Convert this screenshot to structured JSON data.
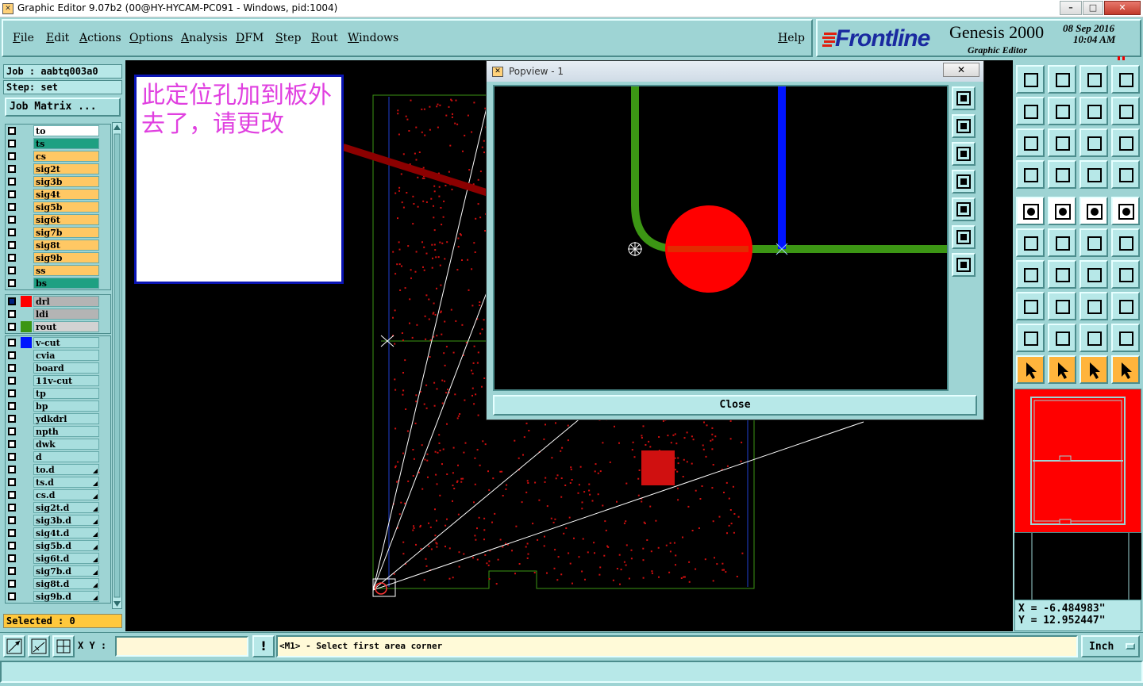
{
  "window": {
    "title": "Graphic Editor 9.07b2 (00@HY-HYCAM-PC091 - Windows, pid:1004)",
    "minimize": "–",
    "maximize": "□",
    "close": "✕"
  },
  "menu": {
    "items": [
      "File",
      "Edit",
      "Actions",
      "Options",
      "Analysis",
      "DFM",
      "Step",
      "Rout",
      "Windows"
    ],
    "help": "Help"
  },
  "brand": {
    "logo": "Frontline",
    "product": "Genesis 2000",
    "subtitle": "Graphic Editor",
    "date": "08 Sep 2016",
    "time": "10:04 AM"
  },
  "job": {
    "job_label": "Job : aabtq003a0",
    "step_label": "Step: set",
    "matrix_button": "Job Matrix ..."
  },
  "layers_board": [
    {
      "name": "to",
      "color": "#ffffff"
    },
    {
      "name": "ts",
      "color": "#1ea082"
    },
    {
      "name": "cs",
      "color": "#ffc864"
    },
    {
      "name": "sig2t",
      "color": "#ffc864"
    },
    {
      "name": "sig3b",
      "color": "#ffc864"
    },
    {
      "name": "sig4t",
      "color": "#ffc864"
    },
    {
      "name": "sig5b",
      "color": "#ffc864"
    },
    {
      "name": "sig6t",
      "color": "#ffc864"
    },
    {
      "name": "sig7b",
      "color": "#ffc864"
    },
    {
      "name": "sig8t",
      "color": "#ffc864"
    },
    {
      "name": "sig9b",
      "color": "#ffc864"
    },
    {
      "name": "ss",
      "color": "#ffc864"
    },
    {
      "name": "bs",
      "color": "#1ea082"
    }
  ],
  "layers_drill": [
    {
      "name": "drl",
      "color": "#b4b4b4",
      "swatch": "#ff0000",
      "active": true
    },
    {
      "name": "ldi",
      "color": "#b4b4b4",
      "swatch": "",
      "active": false
    },
    {
      "name": "rout",
      "color": "#d2d2d2",
      "swatch": "#3c9614",
      "active": false
    }
  ],
  "layers_misc": [
    {
      "name": "v-cut",
      "swatch": "#0014ff",
      "mark": ""
    },
    {
      "name": "cvia",
      "swatch": "",
      "mark": ""
    },
    {
      "name": "board",
      "swatch": "",
      "mark": ""
    },
    {
      "name": "11v-cut",
      "swatch": "",
      "mark": ""
    },
    {
      "name": "tp",
      "swatch": "",
      "mark": ""
    },
    {
      "name": "bp",
      "swatch": "",
      "mark": ""
    },
    {
      "name": "ydkdrl",
      "swatch": "",
      "mark": ""
    },
    {
      "name": "npth",
      "swatch": "",
      "mark": ""
    },
    {
      "name": "dwk",
      "swatch": "",
      "mark": ""
    },
    {
      "name": "d",
      "swatch": "",
      "mark": ""
    },
    {
      "name": "to.d",
      "swatch": "",
      "mark": "◢"
    },
    {
      "name": "ts.d",
      "swatch": "",
      "mark": "◢"
    },
    {
      "name": "cs.d",
      "swatch": "",
      "mark": "◢"
    },
    {
      "name": "sig2t.d",
      "swatch": "",
      "mark": "◢"
    },
    {
      "name": "sig3b.d",
      "swatch": "",
      "mark": "◢"
    },
    {
      "name": "sig4t.d",
      "swatch": "",
      "mark": "◢"
    },
    {
      "name": "sig5b.d",
      "swatch": "",
      "mark": "◢"
    },
    {
      "name": "sig6t.d",
      "swatch": "",
      "mark": "◢"
    },
    {
      "name": "sig7b.d",
      "swatch": "",
      "mark": "◢"
    },
    {
      "name": "sig8t.d",
      "swatch": "",
      "mark": "◢"
    },
    {
      "name": "sig9b.d",
      "swatch": "",
      "mark": "◢"
    }
  ],
  "selected": "Selected : 0",
  "annotation": {
    "text": "此定位孔加到板外去了，请更改"
  },
  "popview": {
    "title": "Popview - 1",
    "close_x": "✕",
    "close_button": "Close"
  },
  "coords": {
    "x": "X = -6.484983\"",
    "y": "Y = 12.952447\""
  },
  "bottom": {
    "xy_label": "X Y :",
    "xy_value": "",
    "warn": "!",
    "prompt": "<M1> - Select first area corner",
    "units": "Inch"
  },
  "colors": {
    "panel": "#9ed4d4",
    "pad_red": "#ff0000",
    "trace_green": "#3c9614",
    "trace_blue": "#0014ff",
    "annotation_text": "#e040e0"
  }
}
